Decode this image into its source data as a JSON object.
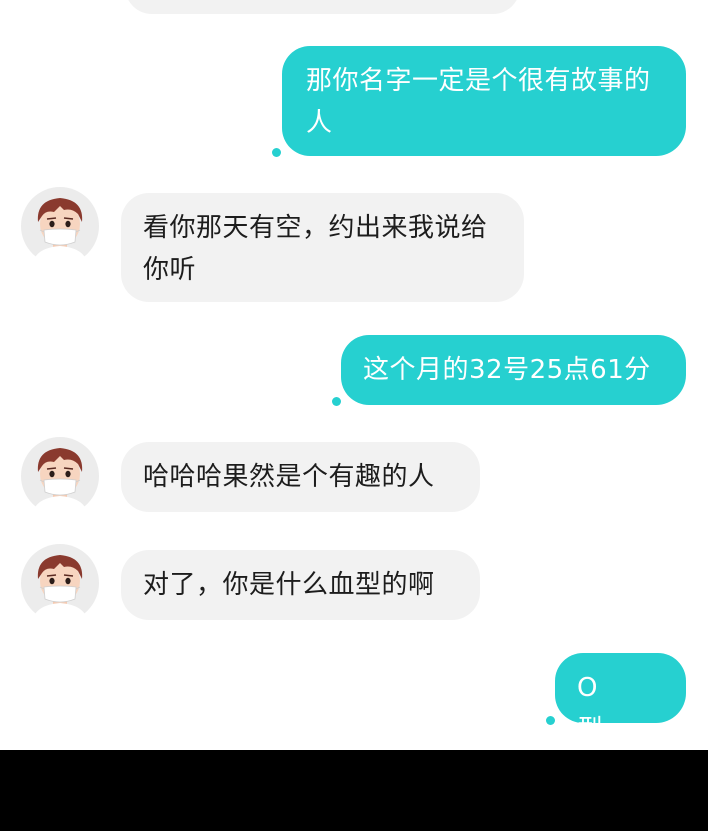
{
  "colors": {
    "outgoing_bubble": "#26d0d0",
    "incoming_bubble": "#f2f2f2",
    "background": "#ffffff",
    "bottom_bar": "#000000"
  },
  "messages": [
    {
      "direction": "outgoing",
      "text": "那你名字一定是个很有故事的人"
    },
    {
      "direction": "incoming",
      "text": "看你那天有空，约出来我说给你听",
      "avatar": "masked-boy-avatar"
    },
    {
      "direction": "outgoing",
      "text": "这个月的32号25点61分"
    },
    {
      "direction": "incoming",
      "text": "哈哈哈果然是个有趣的人",
      "avatar": "masked-boy-avatar"
    },
    {
      "direction": "incoming",
      "text": "对了，你是什么血型的啊",
      "avatar": "masked-boy-avatar"
    },
    {
      "direction": "outgoing",
      "text": "O型……"
    }
  ]
}
